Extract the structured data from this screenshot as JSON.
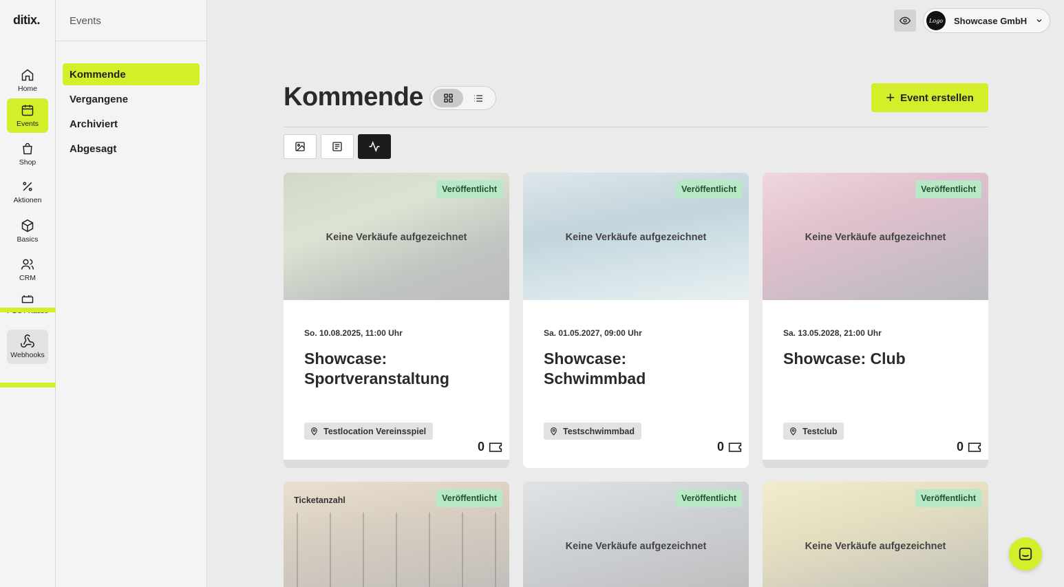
{
  "app": {
    "logo": "ditix."
  },
  "rail": {
    "items": [
      {
        "label": "Home",
        "icon": "home-icon"
      },
      {
        "label": "Events",
        "icon": "calendar-icon"
      },
      {
        "label": "Shop",
        "icon": "shopping-bag-icon"
      },
      {
        "label": "Aktionen",
        "icon": "percent-icon"
      },
      {
        "label": "Basics",
        "icon": "box-icon"
      },
      {
        "label": "CRM",
        "icon": "users-icon"
      },
      {
        "label": "POS / Kasse",
        "icon": "register-icon"
      },
      {
        "label": "Webhooks",
        "icon": "webhook-icon"
      }
    ],
    "active": "Events",
    "hovered": "Webhooks"
  },
  "subnav": {
    "title": "Events",
    "items": [
      {
        "label": "Kommende"
      },
      {
        "label": "Vergangene"
      },
      {
        "label": "Archiviert"
      },
      {
        "label": "Abgesagt"
      }
    ],
    "active": "Kommende"
  },
  "topbar": {
    "org_logo_text": "Logo",
    "org_name": "Showcase GmbH"
  },
  "main": {
    "title": "Kommende",
    "create_label": "Event erstellen"
  },
  "cards": [
    {
      "status": "Veröffentlicht",
      "overlay": "Keine Verkäufe aufgezeichnet",
      "date": "So. 10.08.2025, 11:00 Uhr",
      "title": "Showcase: Sportveranstaltung",
      "location": "Testlocation Vereinsspiel",
      "tickets": "0"
    },
    {
      "status": "Veröffentlicht",
      "overlay": "Keine Verkäufe aufgezeichnet",
      "date": "Sa. 01.05.2027, 09:00 Uhr",
      "title": "Showcase: Schwimmbad",
      "location": "Testschwimmbad",
      "tickets": "0"
    },
    {
      "status": "Veröffentlicht",
      "overlay": "Keine Verkäufe aufgezeichnet",
      "date": "Sa. 13.05.2028, 21:00 Uhr",
      "title": "Showcase: Club",
      "location": "Testclub",
      "tickets": "0"
    },
    {
      "status": "Veröffentlicht",
      "overlay": "Ticketanzahl"
    },
    {
      "status": "Veröffentlicht",
      "overlay": "Keine Verkäufe aufgezeichnet"
    },
    {
      "status": "Veröffentlicht",
      "overlay": "Keine Verkäufe aufgezeichnet"
    }
  ],
  "colors": {
    "accent": "#d4ee2a",
    "badge_bg": "#b9e8c6",
    "badge_text": "#1d5132"
  }
}
